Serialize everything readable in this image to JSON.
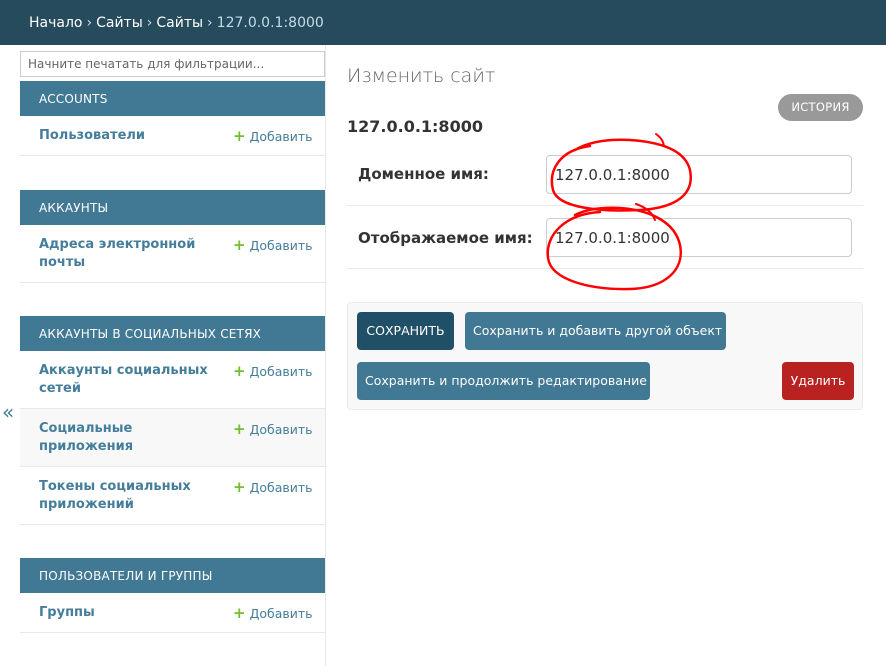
{
  "breadcrumbs": {
    "home": "Начало",
    "app": "Сайты",
    "model": "Сайты",
    "current": "127.0.0.1:8000",
    "separator": "›"
  },
  "sidebar": {
    "filter_placeholder": "Начните печатать для фильтрации...",
    "collapse_icon": "«",
    "modules": [
      {
        "caption": "ACCOUNTS",
        "models": [
          {
            "name": "Пользователи",
            "add": "Добавить"
          }
        ]
      },
      {
        "caption": "АККАУНТЫ",
        "models": [
          {
            "name": "Адреса электронной почты",
            "add": "Добавить"
          }
        ]
      },
      {
        "caption": "АККАУНТЫ В СОЦИАЛЬНЫХ СЕТЯХ",
        "models": [
          {
            "name": "Аккаунты социальных сетей",
            "add": "Добавить"
          },
          {
            "name": "Социальные приложения",
            "add": "Добавить"
          },
          {
            "name": "Токены социальных приложений",
            "add": "Добавить"
          }
        ]
      },
      {
        "caption": "ПОЛЬЗОВАТЕЛИ И ГРУППЫ",
        "models": [
          {
            "name": "Группы",
            "add": "Добавить"
          }
        ]
      }
    ]
  },
  "main": {
    "title": "Изменить сайт",
    "history_label": "ИСТОРИЯ",
    "object_title": "127.0.0.1:8000",
    "fields": [
      {
        "label": "Доменное имя:",
        "value": "127.0.0.1:8000"
      },
      {
        "label": "Отображаемое имя:",
        "value": "127.0.0.1:8000"
      }
    ],
    "buttons": {
      "save": "СОХРАНИТЬ",
      "save_add": "Сохранить и добавить другой объект",
      "save_continue": "Сохранить и продолжить редактирование",
      "delete": "Удалить"
    }
  },
  "colors": {
    "header_bg": "#264b5d",
    "module_caption_bg": "#417893",
    "link": "#447e9b",
    "add_plus": "#70bf2b",
    "save_bg": "#205067",
    "delete_bg": "#ba2121",
    "annotation": "#ff0000"
  }
}
